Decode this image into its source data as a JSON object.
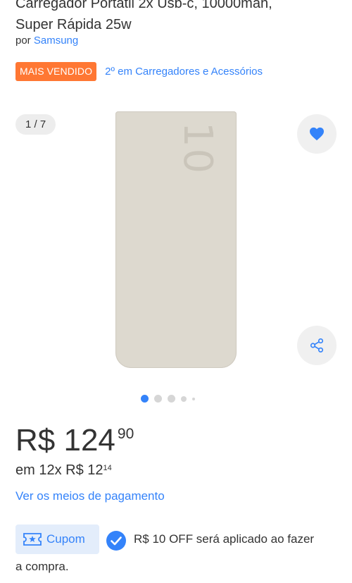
{
  "product": {
    "title_line1": "Carregador Portátil 2x Usb-c, 10000mah,",
    "title_line2": "Super Rápida 25w",
    "by_prefix": "por",
    "brand": "Samsung",
    "badge": "MAIS VENDIDO",
    "rank_link": "2º em Carregadores e Acessórios"
  },
  "gallery": {
    "counter": "1 / 7",
    "current_image": 1,
    "total_images": 7,
    "product_digits": "10",
    "favorite_icon": "heart-icon",
    "share_icon": "share-icon"
  },
  "pricing": {
    "price_main": "R$ 124",
    "price_cents": "90",
    "installments_text": "em 12x R$ 12",
    "installments_cents": "14",
    "payment_link": "Ver os meios de pagamento"
  },
  "coupon": {
    "label": "Cupom",
    "line1": "R$ 10 OFF será aplicado ao fazer",
    "line2": "a compra."
  },
  "colors": {
    "accent": "#3483fa",
    "badge": "#ff7733",
    "product_body": "#ddd9cf"
  }
}
